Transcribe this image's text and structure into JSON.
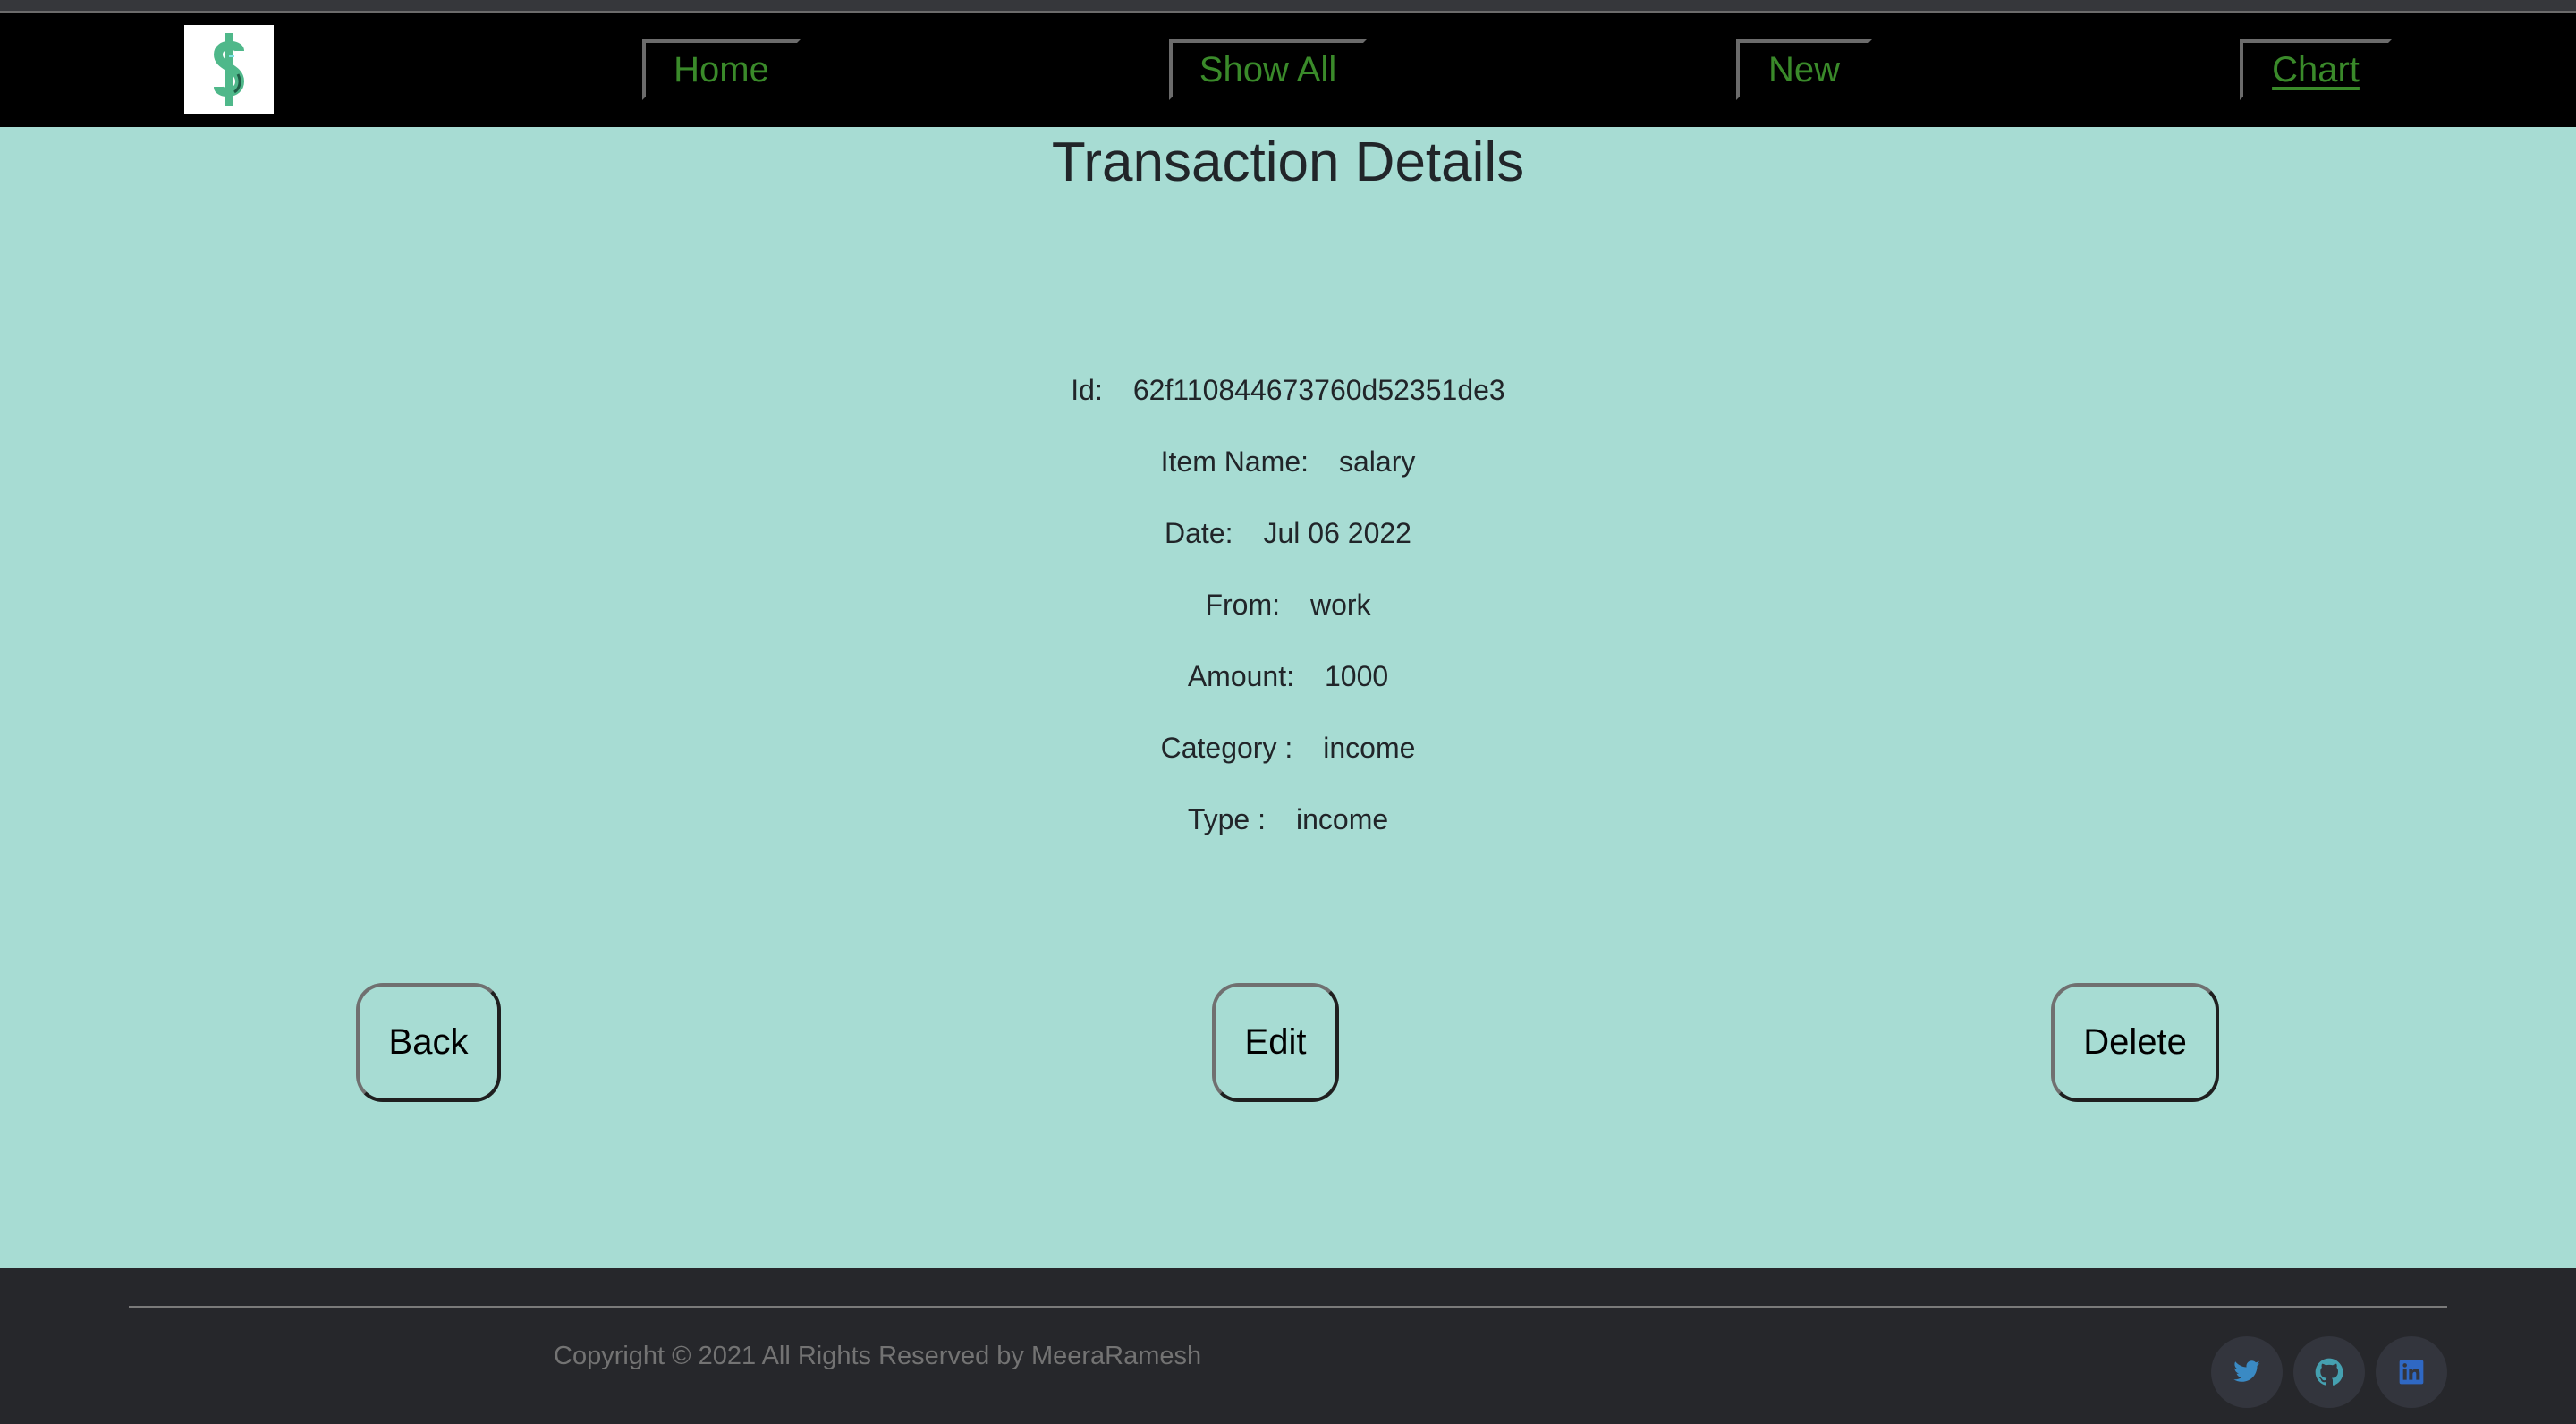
{
  "navbar": {
    "logo_icon": "dollar-sign-icon",
    "items": [
      {
        "label": "Home",
        "active": false
      },
      {
        "label": "Show All",
        "active": false
      },
      {
        "label": "New",
        "active": false
      },
      {
        "label": "Chart",
        "active": true
      }
    ]
  },
  "page": {
    "title": "Transaction Details"
  },
  "details": [
    {
      "label": "Id:",
      "value": "62f110844673760d52351de3"
    },
    {
      "label": "Item Name:",
      "value": "salary"
    },
    {
      "label": "Date:",
      "value": "Jul 06 2022"
    },
    {
      "label": "From:",
      "value": "work"
    },
    {
      "label": "Amount:",
      "value": "1000"
    },
    {
      "label": "Category :",
      "value": "income"
    },
    {
      "label": "Type :",
      "value": "income"
    }
  ],
  "actions": {
    "back_label": "Back",
    "edit_label": "Edit",
    "delete_label": "Delete"
  },
  "footer": {
    "copyright": "Copyright © 2021 All Rights Reserved by MeeraRamesh",
    "social": [
      {
        "icon": "twitter-icon",
        "color": "#3a8ac4"
      },
      {
        "icon": "github-icon",
        "color": "#45a0b0"
      },
      {
        "icon": "linkedin-icon",
        "color": "#2f68c4"
      }
    ]
  },
  "colors": {
    "nav_text": "#3a8a2a",
    "main_bg": "#a7dcd3",
    "footer_bg": "#26272b"
  }
}
